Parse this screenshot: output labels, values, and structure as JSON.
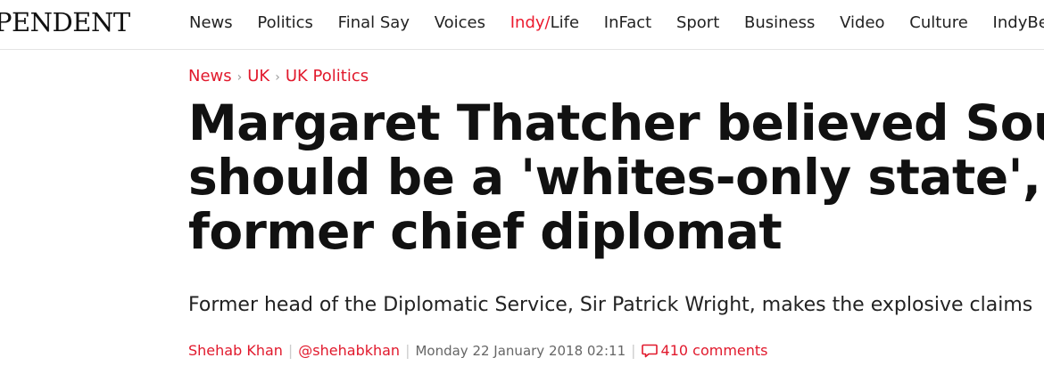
{
  "header": {
    "logo_text": "PENDENT",
    "nav": [
      {
        "label": "News"
      },
      {
        "label": "Politics"
      },
      {
        "label": "Final Say"
      },
      {
        "label": "Voices"
      },
      {
        "label_a": "Indy/",
        "label_b": "Life"
      },
      {
        "label": "InFact"
      },
      {
        "label": "Sport"
      },
      {
        "label": "Business"
      },
      {
        "label": "Video"
      },
      {
        "label": "Culture"
      },
      {
        "label": "IndyBest"
      }
    ]
  },
  "breadcrumb": [
    "News",
    "UK",
    "UK Politics"
  ],
  "article": {
    "headline_lines": [
      "Margaret Thatcher believed South A",
      "should be a 'whites-only state', says",
      "former chief diplomat"
    ],
    "standfirst": "Former head of the Diplomatic Service, Sir Patrick Wright, makes the explosive claims",
    "author": "Shehab Khan",
    "handle": "@shehabkhan",
    "date": "Monday 22 January 2018 02:11",
    "comments": "410 comments"
  },
  "colors": {
    "accent": "#e1192c",
    "text": "#111111"
  }
}
